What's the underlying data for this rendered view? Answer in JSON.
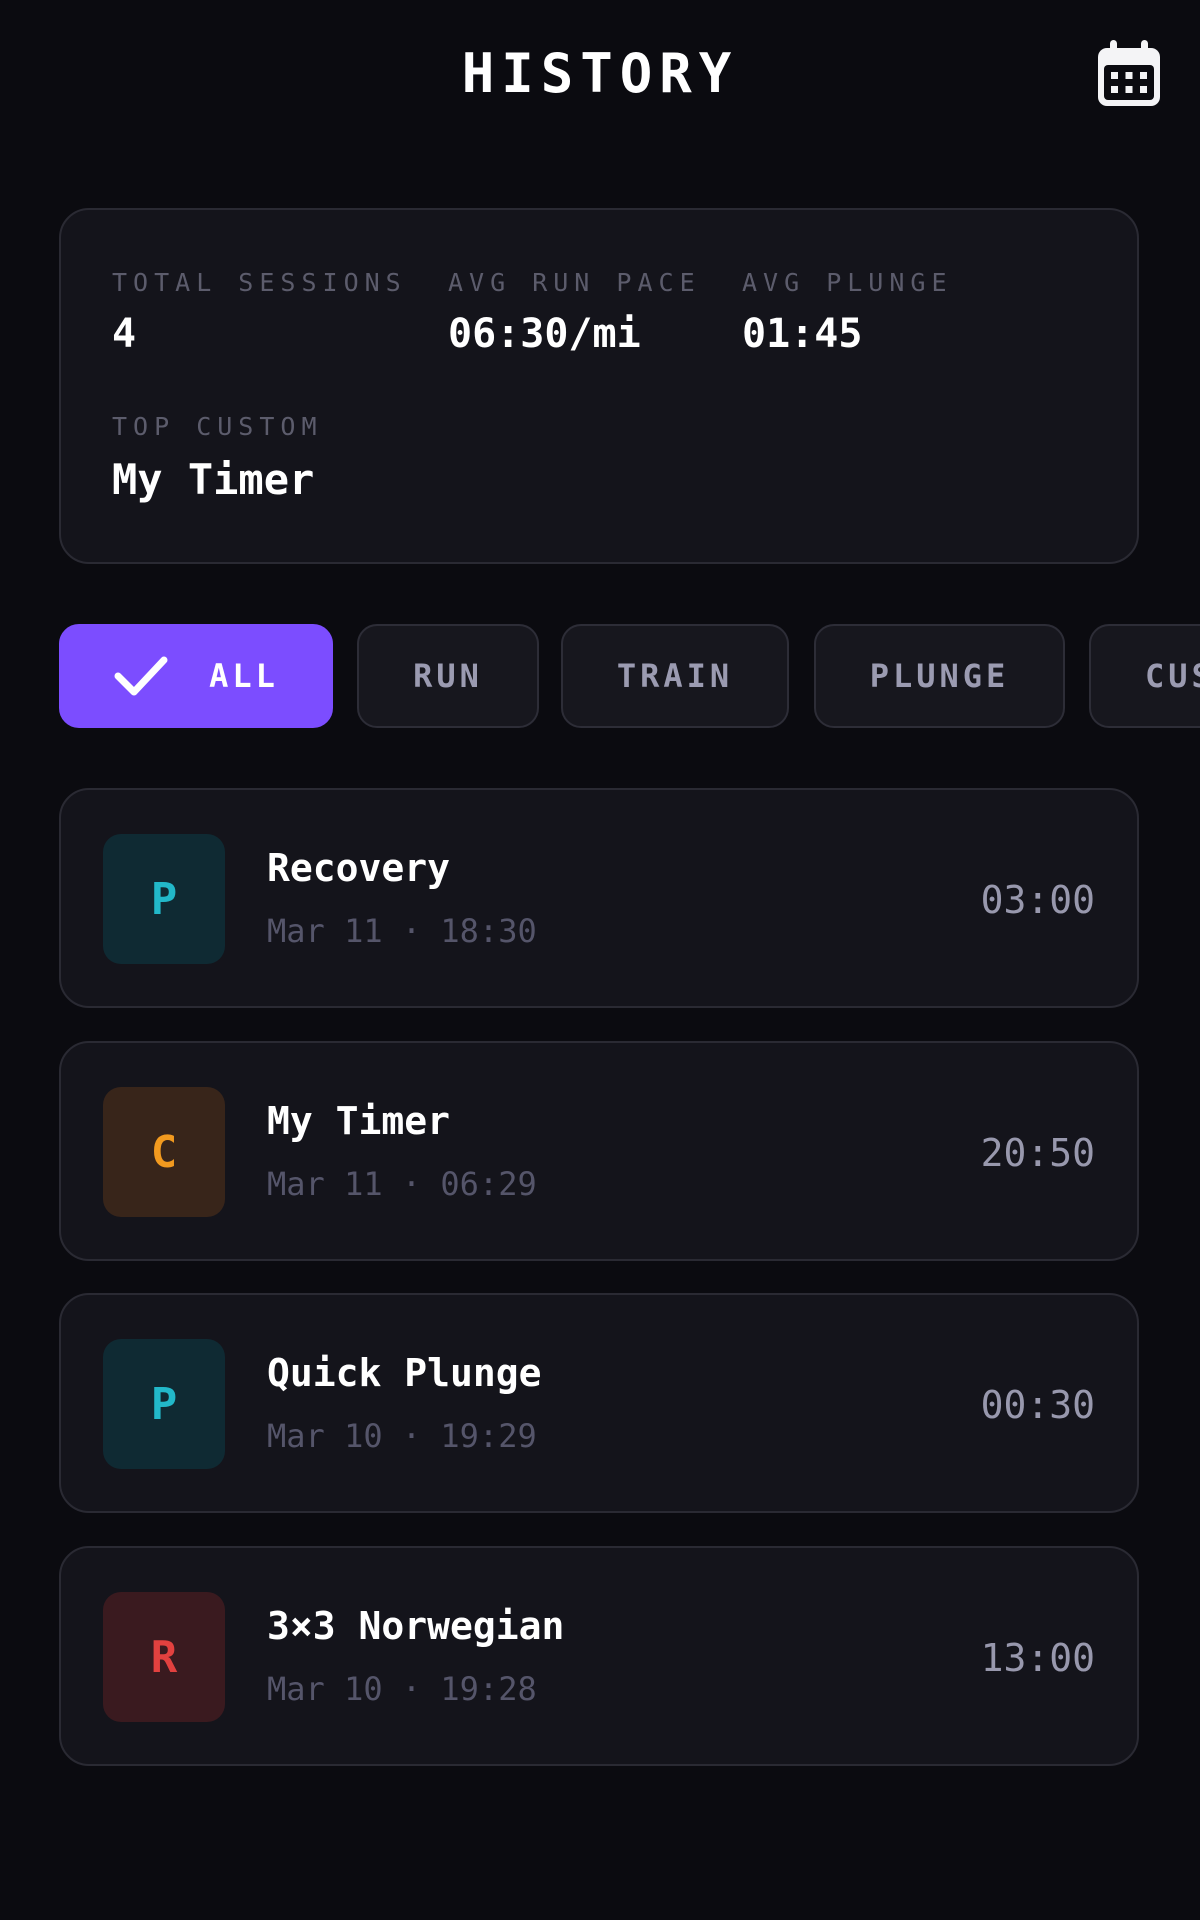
{
  "header": {
    "title": "HISTORY",
    "calendar_icon": "calendar-icon"
  },
  "stats": {
    "total_sessions": {
      "label": "TOTAL SESSIONS",
      "value": "4"
    },
    "avg_run_pace": {
      "label": "AVG RUN PACE",
      "value": "06:30/mi"
    },
    "avg_plunge": {
      "label": "AVG PLUNGE",
      "value": "01:45"
    },
    "top_custom": {
      "label": "TOP CUSTOM",
      "value": "My Timer"
    }
  },
  "filters": [
    {
      "label": "ALL",
      "active": true
    },
    {
      "label": "RUN",
      "active": false
    },
    {
      "label": "TRAIN",
      "active": false
    },
    {
      "label": "PLUNGE",
      "active": false
    },
    {
      "label": "CUSTOM",
      "active": false
    }
  ],
  "sessions": [
    {
      "badge": "P",
      "name": "Recovery",
      "meta": "Mar 11 · 18:30",
      "duration": "03:00",
      "badge_bg": "#0f2a33",
      "badge_fg": "#22b8c9"
    },
    {
      "badge": "C",
      "name": "My Timer",
      "meta": "Mar 11 · 06:29",
      "duration": "20:50",
      "badge_bg": "#38251a",
      "badge_fg": "#f29a1f"
    },
    {
      "badge": "P",
      "name": "Quick Plunge",
      "meta": "Mar 10 · 19:29",
      "duration": "00:30",
      "badge_bg": "#0f2a33",
      "badge_fg": "#22b8c9"
    },
    {
      "badge": "R",
      "name": "3×3 Norwegian",
      "meta": "Mar 10 · 19:28",
      "duration": "13:00",
      "badge_bg": "#3a1a1f",
      "badge_fg": "#e2413f"
    }
  ],
  "colors": {
    "background": "#0b0b10",
    "card": "#14141b",
    "accent": "#7c4dff"
  }
}
